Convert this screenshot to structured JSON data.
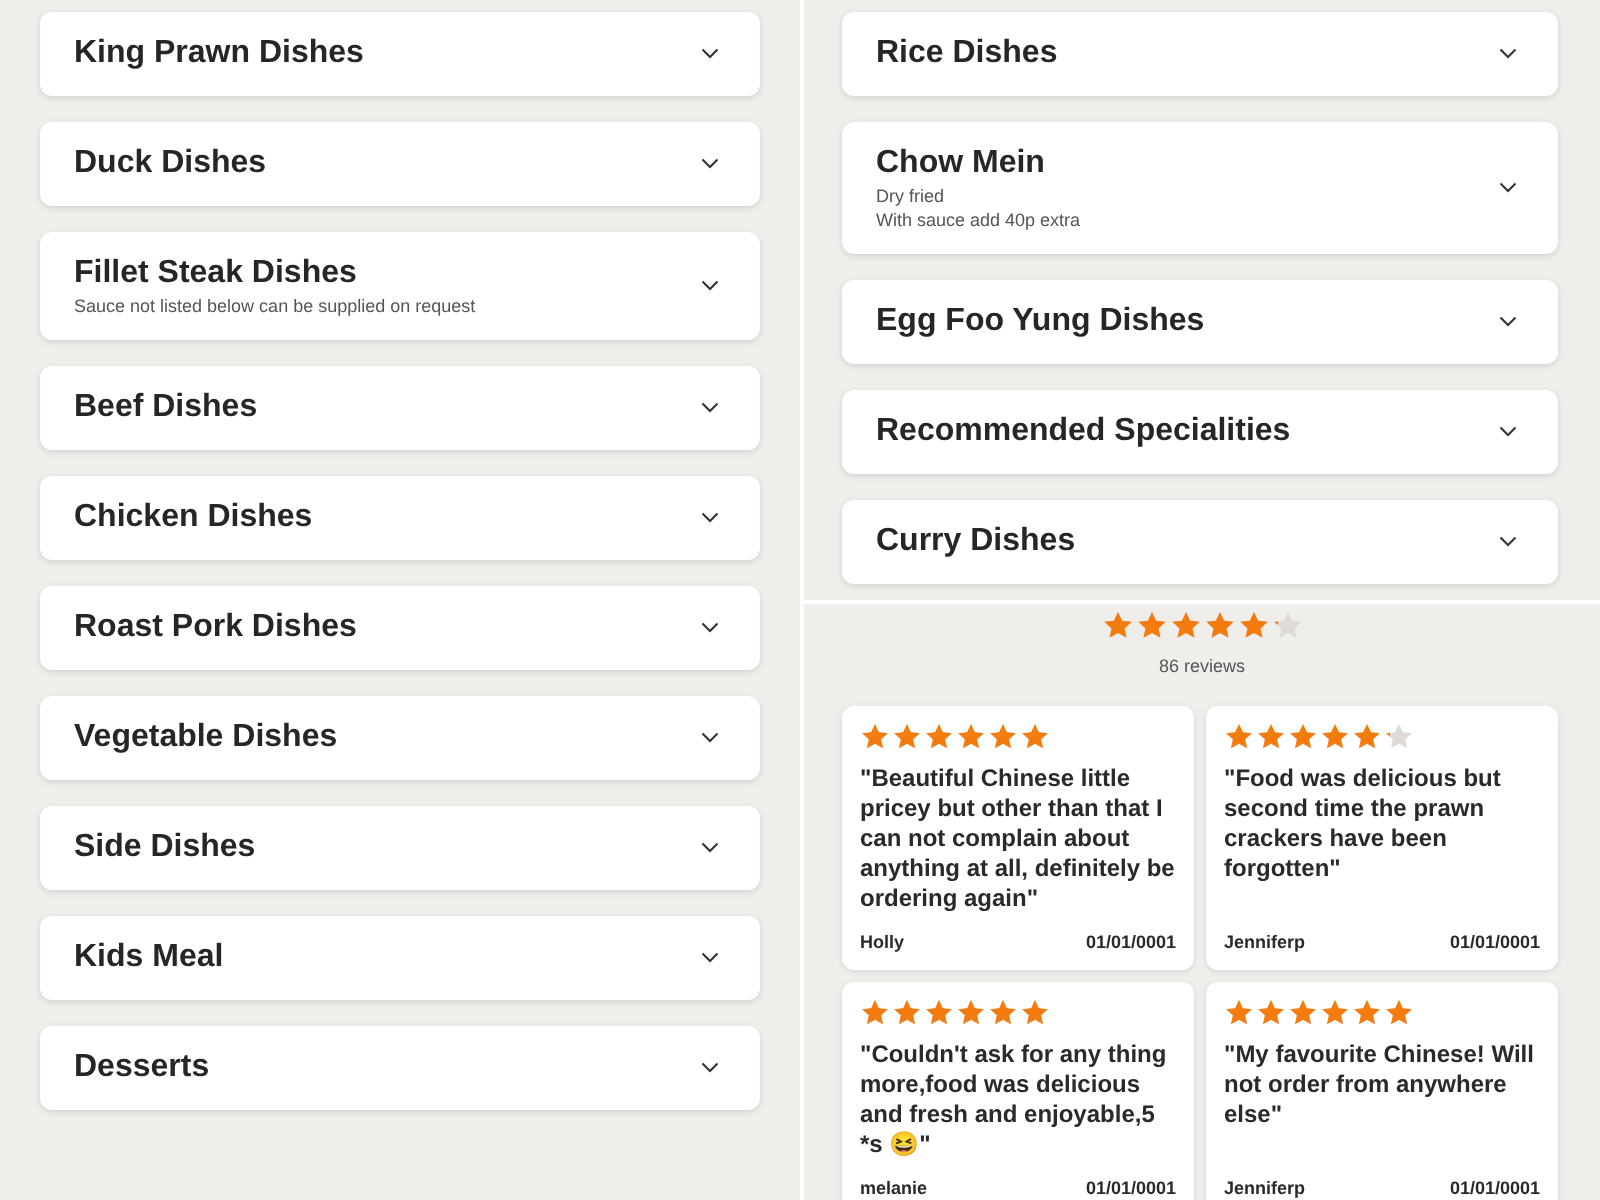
{
  "left_categories": [
    {
      "title": "King Prawn Dishes"
    },
    {
      "title": "Duck Dishes"
    },
    {
      "title": "Fillet Steak Dishes",
      "notes": [
        "Sauce not listed below can be supplied on request"
      ]
    },
    {
      "title": "Beef Dishes"
    },
    {
      "title": "Chicken Dishes"
    },
    {
      "title": "Roast Pork Dishes"
    },
    {
      "title": "Vegetable Dishes"
    },
    {
      "title": "Side Dishes"
    },
    {
      "title": "Kids Meal"
    },
    {
      "title": "Desserts"
    }
  ],
  "right_categories": [
    {
      "title": "Rice Dishes"
    },
    {
      "title": "Chow Mein",
      "notes": [
        "Dry fried",
        "With sauce add 40p extra"
      ]
    },
    {
      "title": "Egg Foo Yung Dishes"
    },
    {
      "title": "Recommended Specialities"
    },
    {
      "title": "Curry Dishes"
    }
  ],
  "rating": {
    "stars": 5.2,
    "count": "86 reviews"
  },
  "reviews": [
    {
      "stars": 6,
      "text": "\"Beautiful Chinese little pricey but other than that I can not complain about anything at all, definitely be ordering again\"",
      "author": "Holly",
      "date": "01/01/0001"
    },
    {
      "stars": 5.2,
      "text": "\"Food was delicious but second time the prawn crackers have been forgotten\"",
      "author": "Jenniferp",
      "date": "01/01/0001"
    },
    {
      "stars": 6,
      "text": "\"Couldn't ask for any thing more,food was delicious and fresh and enjoyable,5 *s 😆\"",
      "author": "melanie",
      "date": "01/01/0001"
    },
    {
      "stars": 6,
      "text": "\"My favourite Chinese! Will not order from anywhere else\"",
      "author": "Jenniferp",
      "date": "01/01/0001"
    }
  ]
}
